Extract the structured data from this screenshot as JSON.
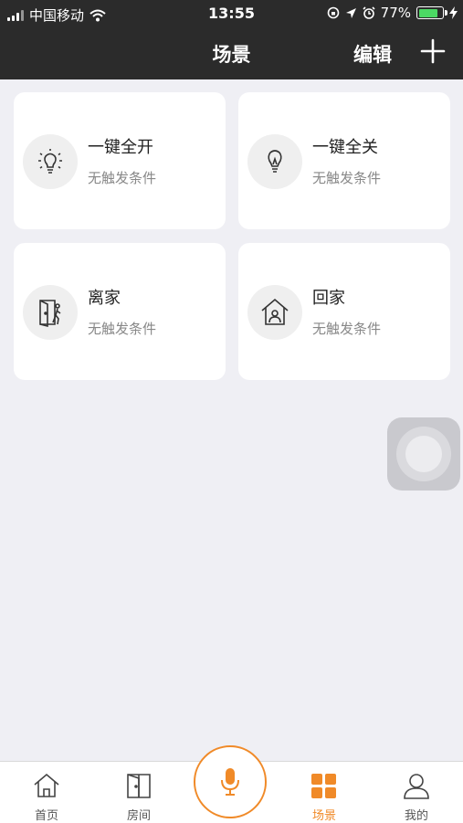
{
  "status_bar": {
    "carrier": "中国移动",
    "time": "13:55",
    "battery": "77%"
  },
  "nav": {
    "title": "场景",
    "edit": "编辑"
  },
  "scenes": [
    {
      "name": "一键全开",
      "condition": "无触发条件",
      "icon": "lightbulb-on-icon"
    },
    {
      "name": "一键全关",
      "condition": "无触发条件",
      "icon": "lightbulb-off-icon"
    },
    {
      "name": "离家",
      "condition": "无触发条件",
      "icon": "leave-home-icon"
    },
    {
      "name": "回家",
      "condition": "无触发条件",
      "icon": "return-home-icon"
    }
  ],
  "tabs": [
    {
      "label": "首页",
      "icon": "home-icon"
    },
    {
      "label": "房间",
      "icon": "door-icon"
    },
    {
      "label": "场景",
      "icon": "grid-icon",
      "active": true
    },
    {
      "label": "我的",
      "icon": "user-icon"
    }
  ],
  "colors": {
    "accent": "#f08a28",
    "header_bg": "#2b2b2b",
    "page_bg": "#efeff4",
    "battery": "#4cd964"
  }
}
